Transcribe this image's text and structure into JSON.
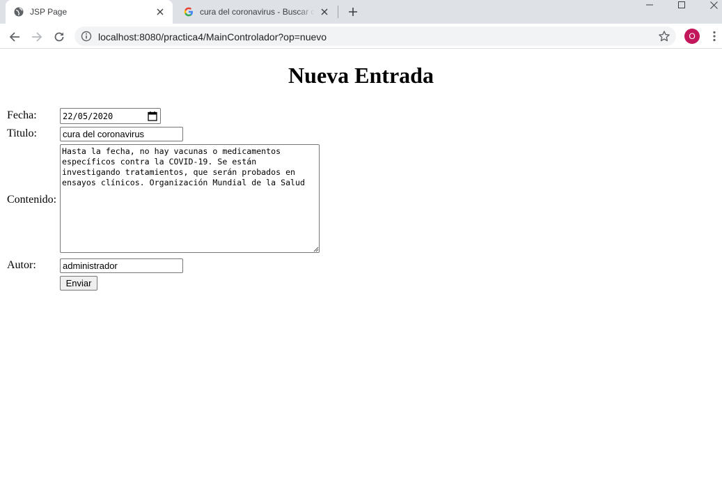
{
  "browser": {
    "tabs": [
      {
        "title": "JSP Page",
        "icon": "globe-icon",
        "active": true
      },
      {
        "title": "cura del coronavirus - Buscar con Google",
        "icon": "google-icon",
        "active": false
      }
    ],
    "address_url": "localhost:8080/practica4/MainControlador?op=nuevo",
    "profile_initial": "O",
    "profile_color": "#c2185b"
  },
  "page": {
    "heading": "Nueva Entrada",
    "form": {
      "fecha_label": "Fecha:",
      "fecha_value": "22/05/2020",
      "titulo_label": "Titulo:",
      "titulo_value": "cura del coronavirus",
      "contenido_label": "Contenido:",
      "contenido_value": "Hasta la fecha, no hay vacunas o medicamentos específicos contra la COVID-19. Se están investigando tratamientos, que serán probados en ensayos clínicos. Organización Mundial de la Salud",
      "autor_label": "Autor:",
      "autor_value": "administrador",
      "submit_label": "Enviar"
    }
  }
}
